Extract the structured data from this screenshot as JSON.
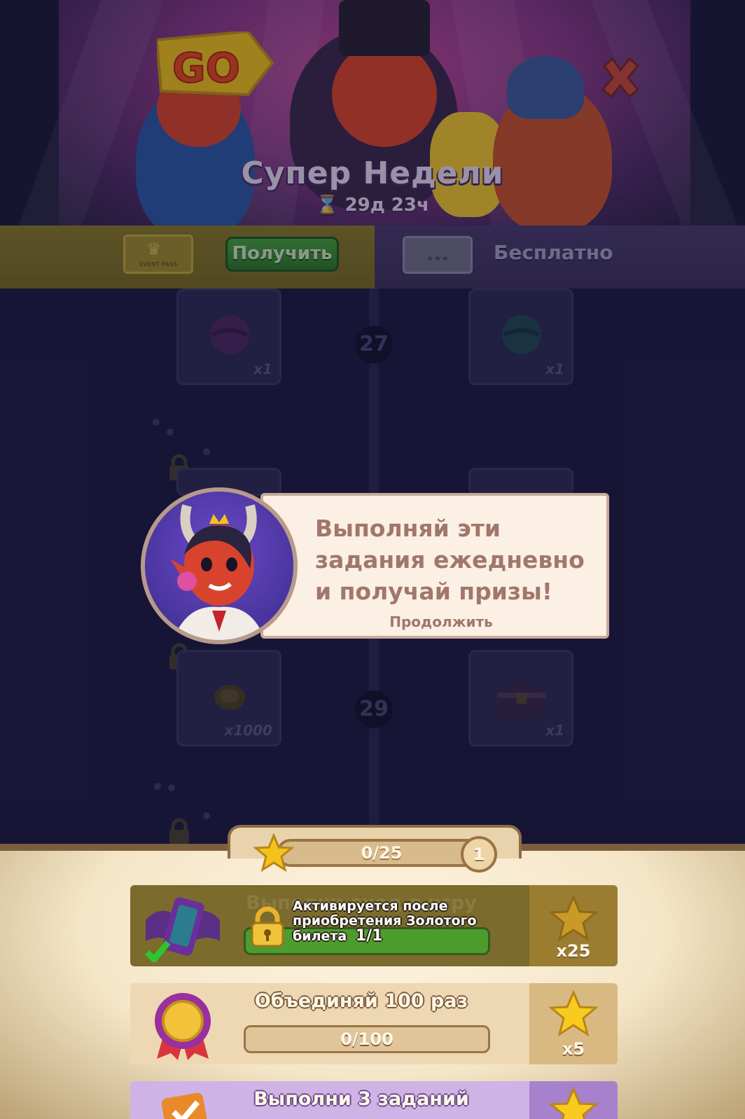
{
  "banner": {
    "title": "Супер Недели",
    "timer": "29д 23ч",
    "sign": "GO",
    "close_icon": "close-x-icon"
  },
  "tabs": {
    "gold_ticket_text": "EVENT PASS",
    "get_label": "Получить",
    "free_label": "Бесплатно"
  },
  "rewards": {
    "rows": [
      {
        "level": "27",
        "left_qty": "x1",
        "right_qty": "x1",
        "left_icon": "purple-sphere-icon",
        "right_icon": "teal-sphere-icon"
      },
      {
        "level": "29",
        "left_qty": "x1000",
        "right_qty": "x1",
        "left_icon": "coin-icon",
        "right_icon": "chest-icon"
      }
    ]
  },
  "tutorial": {
    "message": "Выполняй эти задания ежедневно и получай призы!",
    "continue_label": "Продолжить"
  },
  "progress": {
    "label": "0/25",
    "current": 0,
    "max": 25,
    "level": "1"
  },
  "tasks": [
    {
      "title": "Выполни вход в игру",
      "progress_label": "1/1",
      "progress": 1.0,
      "reward_qty": "x25",
      "completed": true,
      "locked_text": "Активируется после приобретения Золотого билета",
      "locked_progress": "1/1",
      "icon": "phone-bat-icon",
      "colors": {
        "main": "#7b6b2c",
        "reward": "#9b7d32"
      }
    },
    {
      "title": "Объединяй 100 раз",
      "progress_label": "0/100",
      "progress": 0.0,
      "reward_qty": "x5",
      "icon": "medal-icon",
      "colors": {
        "main": "#eed8b3",
        "reward": "#d9b982"
      }
    },
    {
      "title": "Выполни 3 заданий",
      "icon": "checklist-icon",
      "colors": {
        "main": "#cfb3e6",
        "reward": "#a881cc"
      }
    }
  ],
  "colors": {
    "gold_tab": "#8a7b2b",
    "free_tab": "#4b3c6e",
    "grid_bg": "#201d44",
    "bubble_bg": "#fcefe3",
    "bubble_text": "#a0776c",
    "star": "#f5c21b"
  }
}
